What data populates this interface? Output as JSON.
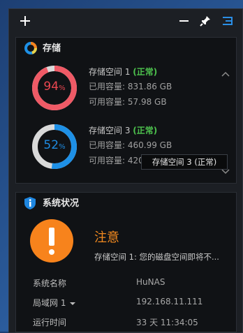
{
  "storage": {
    "title": "存储",
    "volumes": [
      {
        "name": "存储空间 1",
        "status": "(正常)",
        "percent": 94,
        "percent_suffix": "%",
        "used_label": "已用容量",
        "used_value": "831.86 GB",
        "free_label": "可用容量",
        "free_value": "57.98 GB",
        "ring_color": "#ef5a66",
        "text_color": "#ea4750"
      },
      {
        "name": "存储空间 3",
        "status": "(正常)",
        "percent": 52,
        "percent_suffix": "%",
        "used_label": "已用容量",
        "used_value": "460.99 GB",
        "free_label": "可用容量",
        "free_value": "420.85 GB",
        "ring_color": "#1e90e6",
        "text_color": "#1f8be0"
      }
    ],
    "tooltip": "存储空间 3 (正常)"
  },
  "status": {
    "title": "系统状况",
    "level": "注意",
    "message": "存储空间 1: 您的磁盘空间即将不...",
    "rows": [
      {
        "label": "系统名称",
        "value": "HuNAS"
      },
      {
        "label": "局域网 1",
        "value": "192.168.11.111"
      },
      {
        "label": "运行时间",
        "value": "33 天 11:34:05"
      }
    ]
  },
  "toolbar": {
    "add_icon": "plus-icon",
    "min_icon": "minimize-icon",
    "pin_icon": "pin-icon",
    "list_icon": "list-icon"
  },
  "colors": {
    "accent_blue": "#1e90e6",
    "warning": "#f7831c",
    "ok_green": "#4dc14d"
  }
}
